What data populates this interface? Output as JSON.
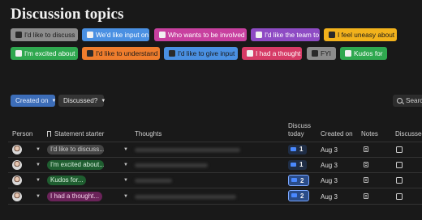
{
  "page_title": "Discussion topics",
  "tags": [
    {
      "label": "I'd like to discuss",
      "color": "#8c8c8c",
      "text": "dark"
    },
    {
      "label": "We'd like input on",
      "color": "#4a90e2",
      "text": "light"
    },
    {
      "label": "Who wants to be involved",
      "color": "#c8409f",
      "text": "light"
    },
    {
      "label": "I'd like the team to",
      "color": "#8e4bc4",
      "text": "light"
    },
    {
      "label": "I feel uneasy about",
      "color": "#f2b21c",
      "text": "dark"
    },
    {
      "label": "I'm excited about",
      "color": "#2fa84f",
      "text": "light"
    },
    {
      "label": "I'd like to understand",
      "color": "#ef7d2d",
      "text": "dark"
    },
    {
      "label": "I'd like to give input",
      "color": "#4a90e2",
      "text": "dark"
    },
    {
      "label": "I had a thought",
      "color": "#d63b66",
      "text": "light"
    },
    {
      "label": "FYI",
      "color": "#8c8c8c",
      "text": "dark"
    },
    {
      "label": "Kudos for",
      "color": "#2fa84f",
      "text": "light"
    }
  ],
  "toolbar": {
    "created_on": "Created on",
    "discussed": "Discussed?",
    "search": "Search"
  },
  "columns": {
    "person": "Person",
    "statement": "Statement starter",
    "thoughts": "Thoughts",
    "discuss_today_line1": "Discuss",
    "discuss_today_line2": "today",
    "created_on": "Created on",
    "notes": "Notes",
    "discussed": "Discussed?"
  },
  "rows": [
    {
      "statement": "I'd like to discuss...",
      "pill_bg": "#454545",
      "pill_fg": "#cfcfcf",
      "discuss_count": "1",
      "selected": false,
      "created": "Aug 3",
      "discussed": false
    },
    {
      "statement": "I'm excited about...",
      "pill_bg": "#1f5e30",
      "pill_fg": "#d9f0de",
      "discuss_count": "1",
      "selected": false,
      "created": "Aug 3",
      "discussed": false
    },
    {
      "statement": "Kudos for...",
      "pill_bg": "#1f5e30",
      "pill_fg": "#d9f0de",
      "discuss_count": "2",
      "selected": true,
      "created": "Aug 3",
      "discussed": false
    },
    {
      "statement": "I had a thought...",
      "pill_bg": "#6a2359",
      "pill_fg": "#f2cfe7",
      "discuss_count": "2",
      "selected": true,
      "created": "Aug 3",
      "discussed": false
    }
  ]
}
